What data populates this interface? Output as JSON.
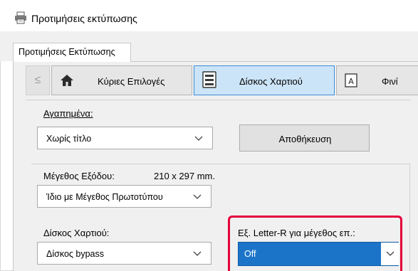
{
  "window": {
    "title": "Προτιμήσεις εκτύπωσης",
    "icon": "printer-icon"
  },
  "tabs": [
    {
      "label": "Προτιμήσεις Εκτύπωσης",
      "selected": true
    }
  ],
  "nav": {
    "back_label": "≤",
    "items": [
      {
        "label": "Κύριες Επιλογές",
        "icon": "home-icon",
        "selected": false
      },
      {
        "label": "Δίσκος Χαρτιού",
        "icon": "paper-tray-icon",
        "selected": true
      },
      {
        "label": "Φινί",
        "icon": "finishing-icon",
        "selected": false
      }
    ]
  },
  "favorites": {
    "label": "Αγαπημένα:",
    "value": "Χωρίς τίτλο",
    "save_label": "Αποθήκευση"
  },
  "output_size": {
    "label": "Μέγεθος Εξόδου:",
    "dimensions": "210 x 297 mm.",
    "value": "Ίδιο με Μέγεθος Πρωτοτύπου"
  },
  "paper_tray": {
    "label": "Δίσκος Χαρτιού:",
    "value": "Δίσκος bypass"
  },
  "letter_r": {
    "label": "Εξ. Letter-R για μέγεθος επ.:",
    "value": "Off"
  },
  "colors": {
    "selected_nav_bg": "#cce4f7",
    "highlight_border": "#e4003a",
    "selected_combo_bg": "#1c74c9"
  }
}
